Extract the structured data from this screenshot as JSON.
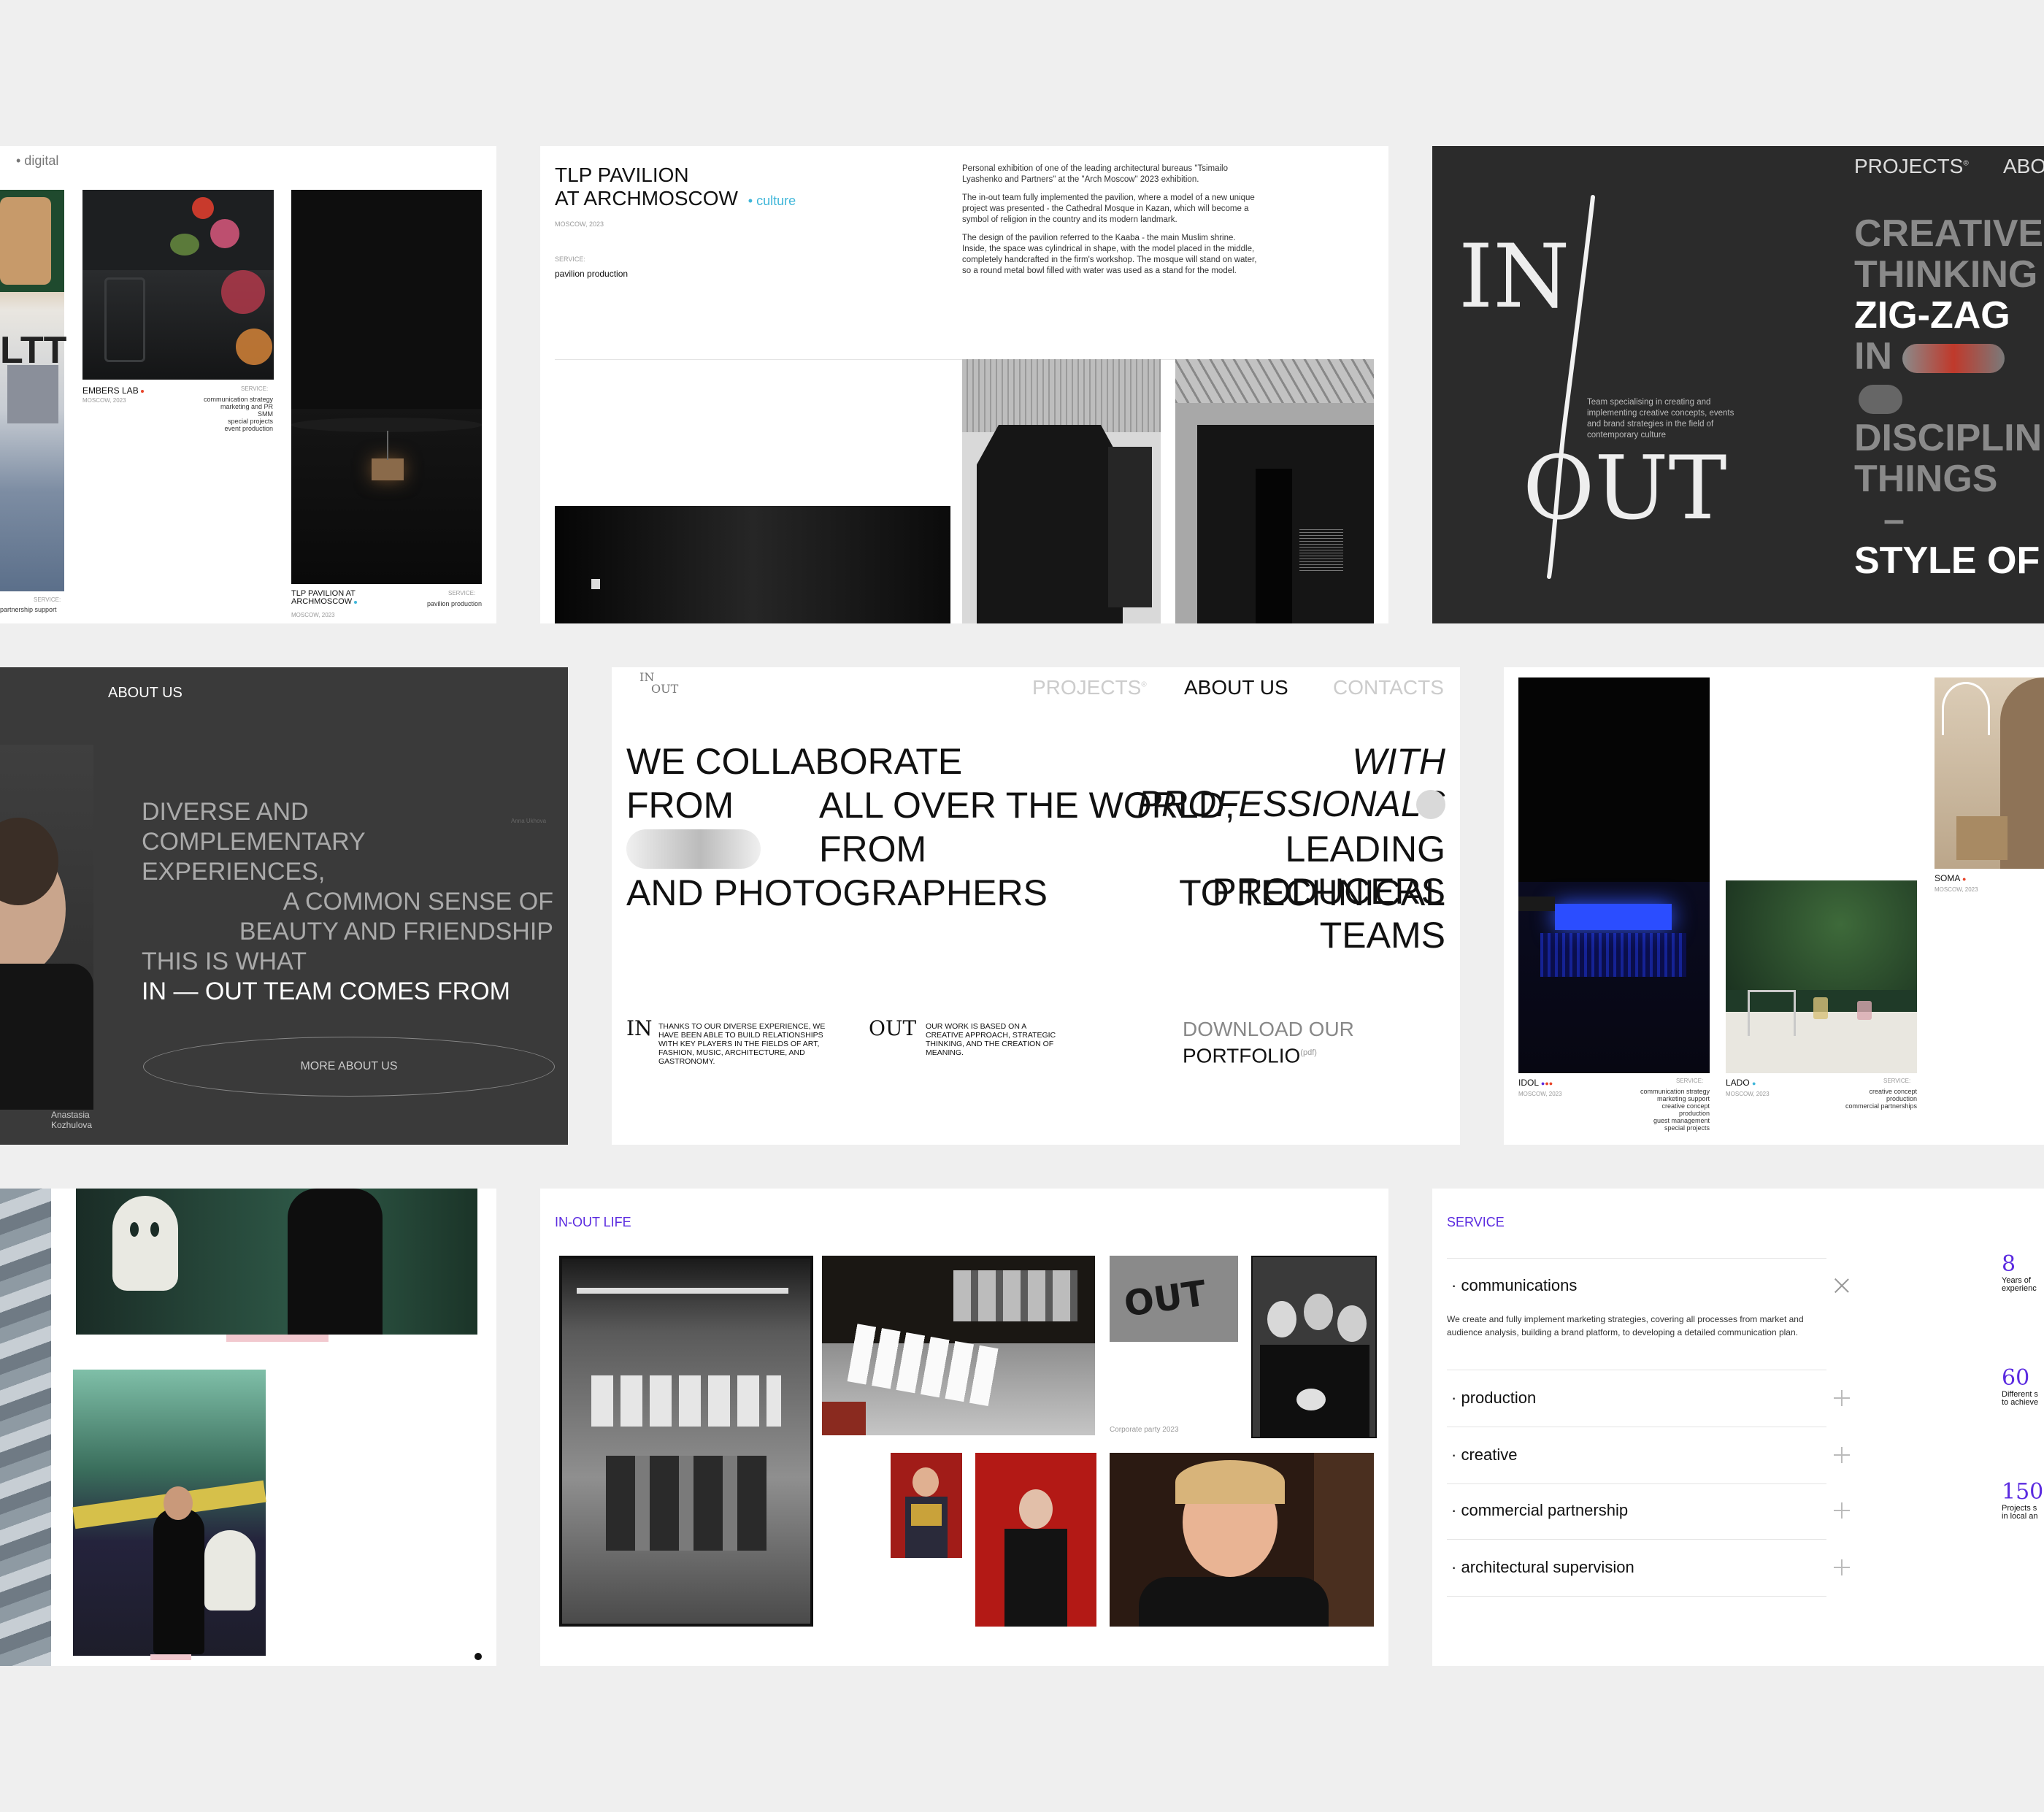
{
  "colors": {
    "page_bg": "#efefef",
    "dark_card": "#2b2b2b",
    "accent_purple": "#5b2be0",
    "accent_cyan": "#3fb6d9",
    "accent_red": "#e8452a"
  },
  "card1": {
    "tag": "• digital",
    "left_service_label": "SERVICE:",
    "left_service_text": "partnership support",
    "embers": {
      "name": "EMBERS LAB",
      "city": "MOSCOW, 2023",
      "service_label": "SERVICE:",
      "services": [
        "communication strategy",
        "marketing and PR",
        "SMM",
        "special projects",
        "event production"
      ]
    },
    "tlp": {
      "name": "TLP PAVILION AT ARCHMOSCOW",
      "city": "MOSCOW, 2023",
      "service_label": "SERVICE:",
      "service": "pavilion production"
    }
  },
  "card2": {
    "title_l1": "TLP PAVILION",
    "title_l2": "AT ARCHMOSCOW",
    "tag": "• culture",
    "city": "MOSCOW, 2023",
    "service_label": "SERVICE:",
    "service": "pavilion production",
    "p1": "Personal exhibition of one of the leading architectural bureaus \"Tsimailo Lyashenko and Partners\" at the \"Arch Moscow\" 2023 exhibition.",
    "p2": "The in-out team fully implemented the pavilion, where a model of a new unique project was presented - the Cathedral Mosque in Kazan, which will become a symbol of religion in the country and its modern landmark.",
    "p3": "The design of the pavilion referred to the Kaaba - the main Muslim shrine. Inside, the space was cylindrical in shape, with the model placed in the middle, completely handcrafted in the firm's workshop. The mosque will stand on water, so a round metal bowl filled with water was used as a stand for the model."
  },
  "card3": {
    "nav": [
      "PROJECTS",
      "ABO"
    ],
    "logo_in": "IN",
    "logo_out": "OUT",
    "team_text": "Team specialising in creating and implementing creative concepts, events and brand strategies in the field of contemporary culture",
    "words": [
      "CREATIVE",
      "THINKING",
      "ZIG-ZAG",
      "IN",
      "DISCIPLIN",
      "THINGS",
      "STYLE OF"
    ]
  },
  "card4": {
    "header": "ABOUT US",
    "caption": "Anna Ukhova",
    "lines": [
      "DIVERSE AND",
      "COMPLEMENTARY EXPERIENCES,",
      "A COMMON SENSE OF",
      "BEAUTY AND FRIENDSHIP",
      "THIS IS WHAT",
      "IN — OUT TEAM COMES FROM"
    ],
    "button": "MORE ABOUT US",
    "person_l1": "Anastasia",
    "person_l2": "Kozhulova"
  },
  "card5": {
    "logo_in": "IN",
    "logo_out": "OUT",
    "nav": [
      "PROJECTS",
      "ABOUT US",
      "CONTACTS"
    ],
    "h_r1a": "WE COLLABORATE",
    "h_r1b": "WITH PROFESSIONALS",
    "h_r2a": "FROM",
    "h_r2b": "ALL OVER THE WORLD,",
    "h_r3a": "FROM",
    "h_r3b": "LEADING PRODUCERS",
    "h_r4a": "AND PHOTOGRAPHERS",
    "h_r4b": "TO TECHNICAL TEAMS",
    "in_label": "IN",
    "in_text": "THANKS TO OUR DIVERSE EXPERIENCE, WE HAVE BEEN ABLE TO BUILD RELATIONSHIPS WITH KEY PLAYERS IN THE FIELDS OF ART, FASHION, MUSIC, ARCHITECTURE, AND GASTRONOMY.",
    "out_label": "OUT",
    "out_text": "OUR WORK IS BASED ON A CREATIVE APPROACH, STRATEGIC THINKING, AND THE CREATION OF MEANING.",
    "download_l1": "DOWNLOAD OUR",
    "download_l2": "PORTFOLIO",
    "pdf": "(pdf)"
  },
  "card6": {
    "idol": {
      "name": "IDOL",
      "city": "MOSCOW, 2023",
      "service_label": "SERVICE:",
      "services": [
        "communication strategy",
        "marketing support",
        "creative concept",
        "production",
        "guest management",
        "special projects"
      ]
    },
    "lado": {
      "name": "LADO",
      "city": "MOSCOW, 2023",
      "service_label": "SERVICE:",
      "services": [
        "creative concept",
        "production",
        "commercial partnerships"
      ]
    },
    "soma": {
      "name": "SOMA",
      "city": "MOSCOW, 2023"
    }
  },
  "card8": {
    "header": "IN-OUT LIFE",
    "caption": "Corporate party 2023"
  },
  "card9": {
    "header": "SERVICE",
    "items": [
      "communications",
      "production",
      "creative",
      "commercial partnership",
      "architectural supervision"
    ],
    "desc": "We create and fully implement marketing strategies, covering all processes from market and audience analysis, building a brand platform, to developing a detailed communication plan.",
    "stats": [
      {
        "num": "8",
        "l1": "Years of",
        "l2": "experienc"
      },
      {
        "num": "60",
        "l1": "Different s",
        "l2": "to achieve"
      },
      {
        "num": "150",
        "l1": "Projects s",
        "l2": "in local an"
      }
    ]
  }
}
